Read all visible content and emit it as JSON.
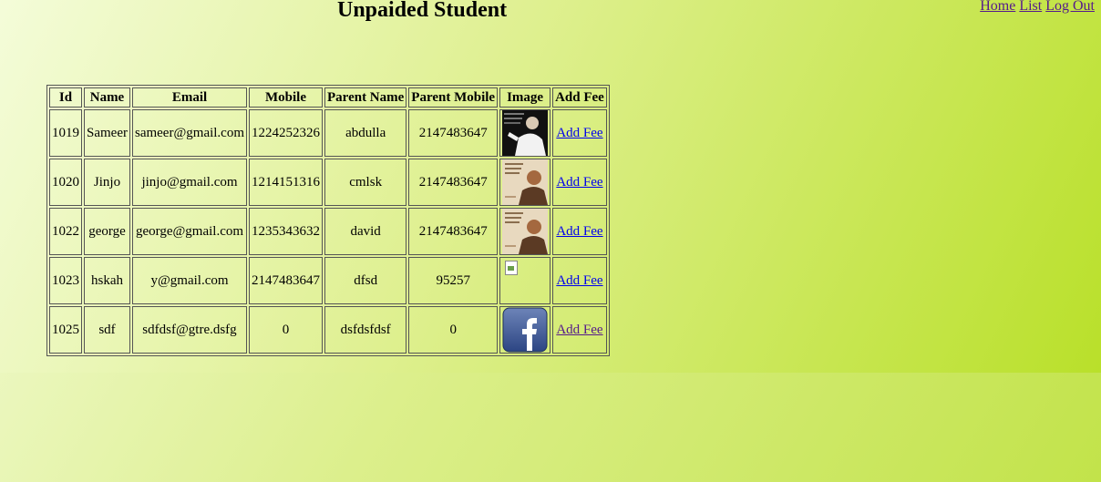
{
  "nav": {
    "home": "Home",
    "list": "List",
    "logout": "Log Out"
  },
  "page": {
    "title": "Unpaided Student"
  },
  "table": {
    "headers": [
      "Id",
      "Name",
      "Email",
      "Mobile",
      "Parent Name",
      "Parent Mobile",
      "Image",
      "Add Fee"
    ],
    "rows": [
      {
        "id": "1019",
        "name": "Sameer",
        "email": "sameer@gmail.com",
        "mobile": "1224252326",
        "parent_name": "abdulla",
        "parent_mobile": "2147483647",
        "image": "portrait-speaker",
        "action": "Add Fee"
      },
      {
        "id": "1020",
        "name": "Jinjo",
        "email": "jinjo@gmail.com",
        "mobile": "1214151316",
        "parent_name": "cmlsk",
        "parent_mobile": "2147483647",
        "image": "portrait-sepia",
        "action": "Add Fee"
      },
      {
        "id": "1022",
        "name": "george",
        "email": "george@gmail.com",
        "mobile": "1235343632",
        "parent_name": "david",
        "parent_mobile": "2147483647",
        "image": "portrait-sepia",
        "action": "Add Fee"
      },
      {
        "id": "1023",
        "name": "hskah",
        "email": "y@gmail.com",
        "mobile": "2147483647",
        "parent_name": "dfsd",
        "parent_mobile": "95257",
        "image": "broken-image",
        "action": "Add Fee"
      },
      {
        "id": "1025",
        "name": "sdf",
        "email": "sdfdsf@gtre.dsfg",
        "mobile": "0",
        "parent_name": "dsfdsfdsf",
        "parent_mobile": "0",
        "image": "facebook-logo",
        "action": "Add Fee"
      }
    ]
  },
  "colors": {
    "link": "#0000ee",
    "visited": "#551a8b",
    "bg_start": "#f4fcd9",
    "bg_end": "#b9e02a"
  }
}
